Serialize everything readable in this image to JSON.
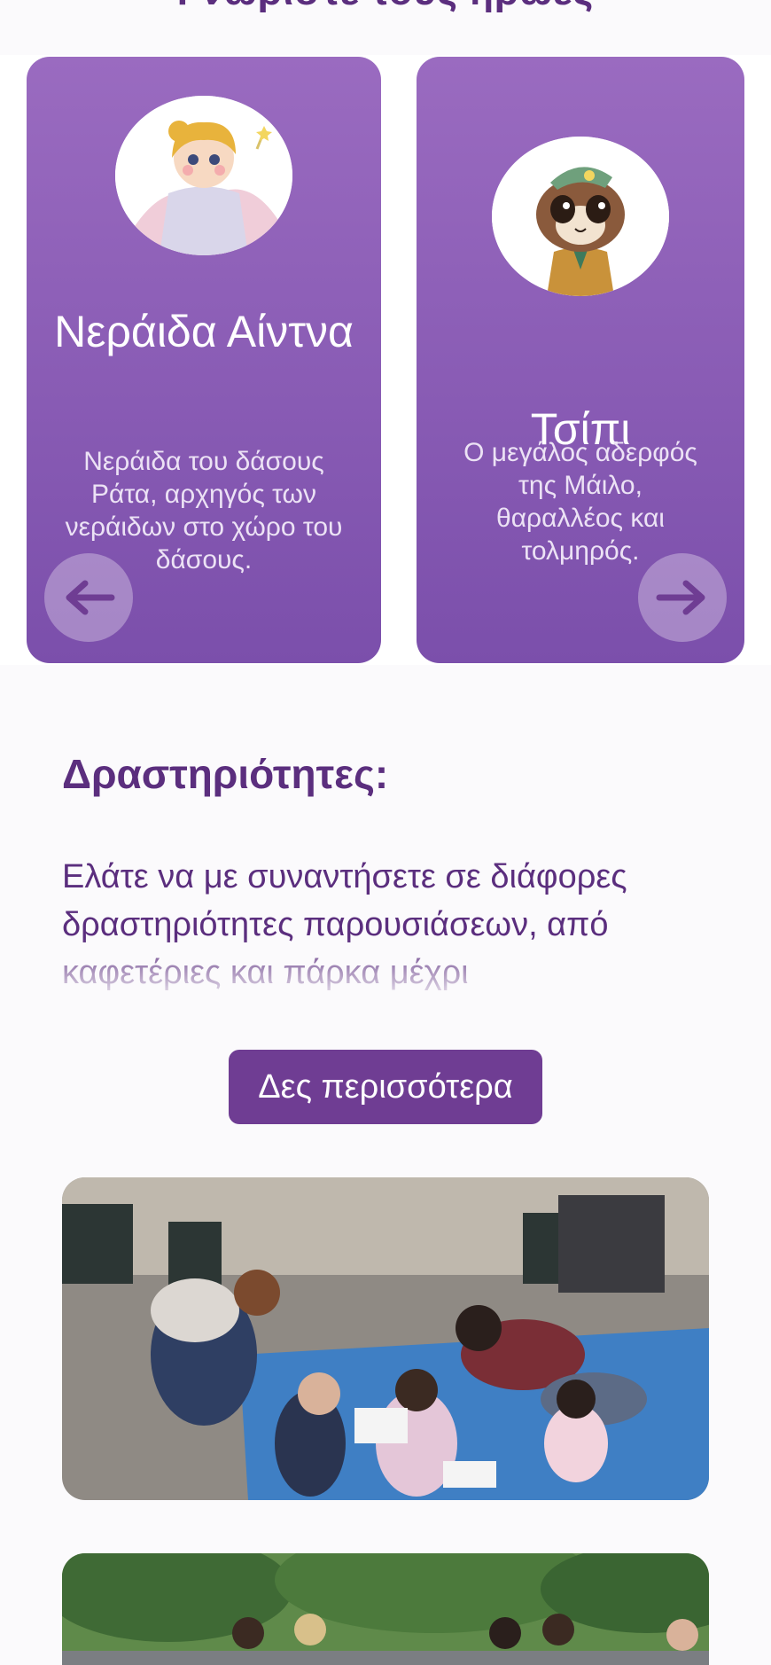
{
  "top_heading": "Γνωρίστε τους ήρωες",
  "carousel": {
    "cards": [
      {
        "name": "Νεράιδα Αίντνα",
        "description": "Νεράιδα του δάσους Ράτα, αρχηγός των νεράιδων στο χώρο του δάσους.",
        "avatar_icon": "fairy-illustration"
      },
      {
        "name": "Τσίπι",
        "description": "Ο μεγάλος αδερφός της Μάιλο, θαραλλέος και τολμηρός.",
        "avatar_icon": "chipmunk-illustration"
      }
    ],
    "prev_icon": "arrow-left-icon",
    "next_icon": "arrow-right-icon"
  },
  "activities": {
    "title": "Δραστηριότητες:",
    "text": "Ελάτε να με συναντήσετε σε διάφορες δραστηριότητες παρουσιάσεων, από καφετέριες και πάρκα μέχρι",
    "more_button": "Δες περισσότερα"
  },
  "photos": [
    "event-photo-park-kids",
    "event-photo-park-crowd"
  ],
  "colors": {
    "brand_purple": "#6f3d93",
    "heading_purple": "#5b2e7e",
    "card_gradient_top": "#9a6bc0",
    "card_gradient_bottom": "#7b4fab"
  }
}
